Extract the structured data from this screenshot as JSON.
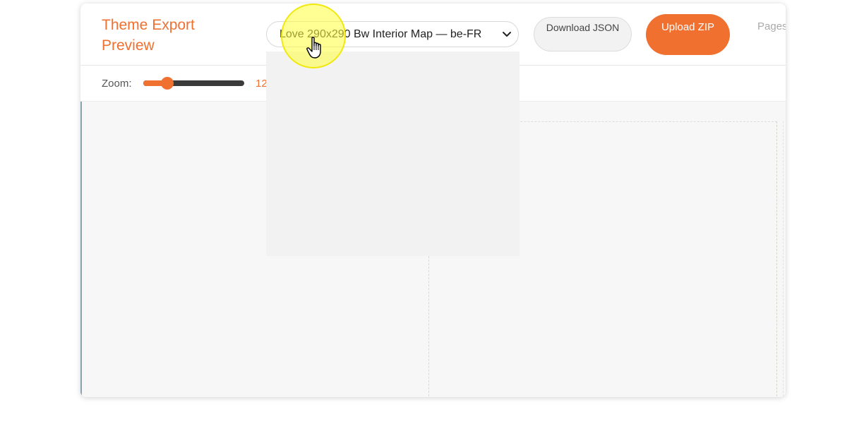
{
  "header": {
    "title": "Theme Export Preview",
    "theme_select": {
      "value": "Love 290x290 Bw Interior Map — be-FR"
    },
    "download_json_label": "Download JSON",
    "upload_zip_label": "Upload ZIP",
    "pages_label": "Pages"
  },
  "zoom": {
    "label": "Zoom:",
    "value_text": "12",
    "slider_fraction": 0.24
  },
  "colors": {
    "accent": "#f07030",
    "dropdown_panel": "#f2f2f2",
    "canvas": "#f7f7f7",
    "cursor_highlight": "#ffff3c"
  },
  "icons": {
    "select_chevron": "chevron-down-icon",
    "cursor": "pointer-hand-icon"
  }
}
